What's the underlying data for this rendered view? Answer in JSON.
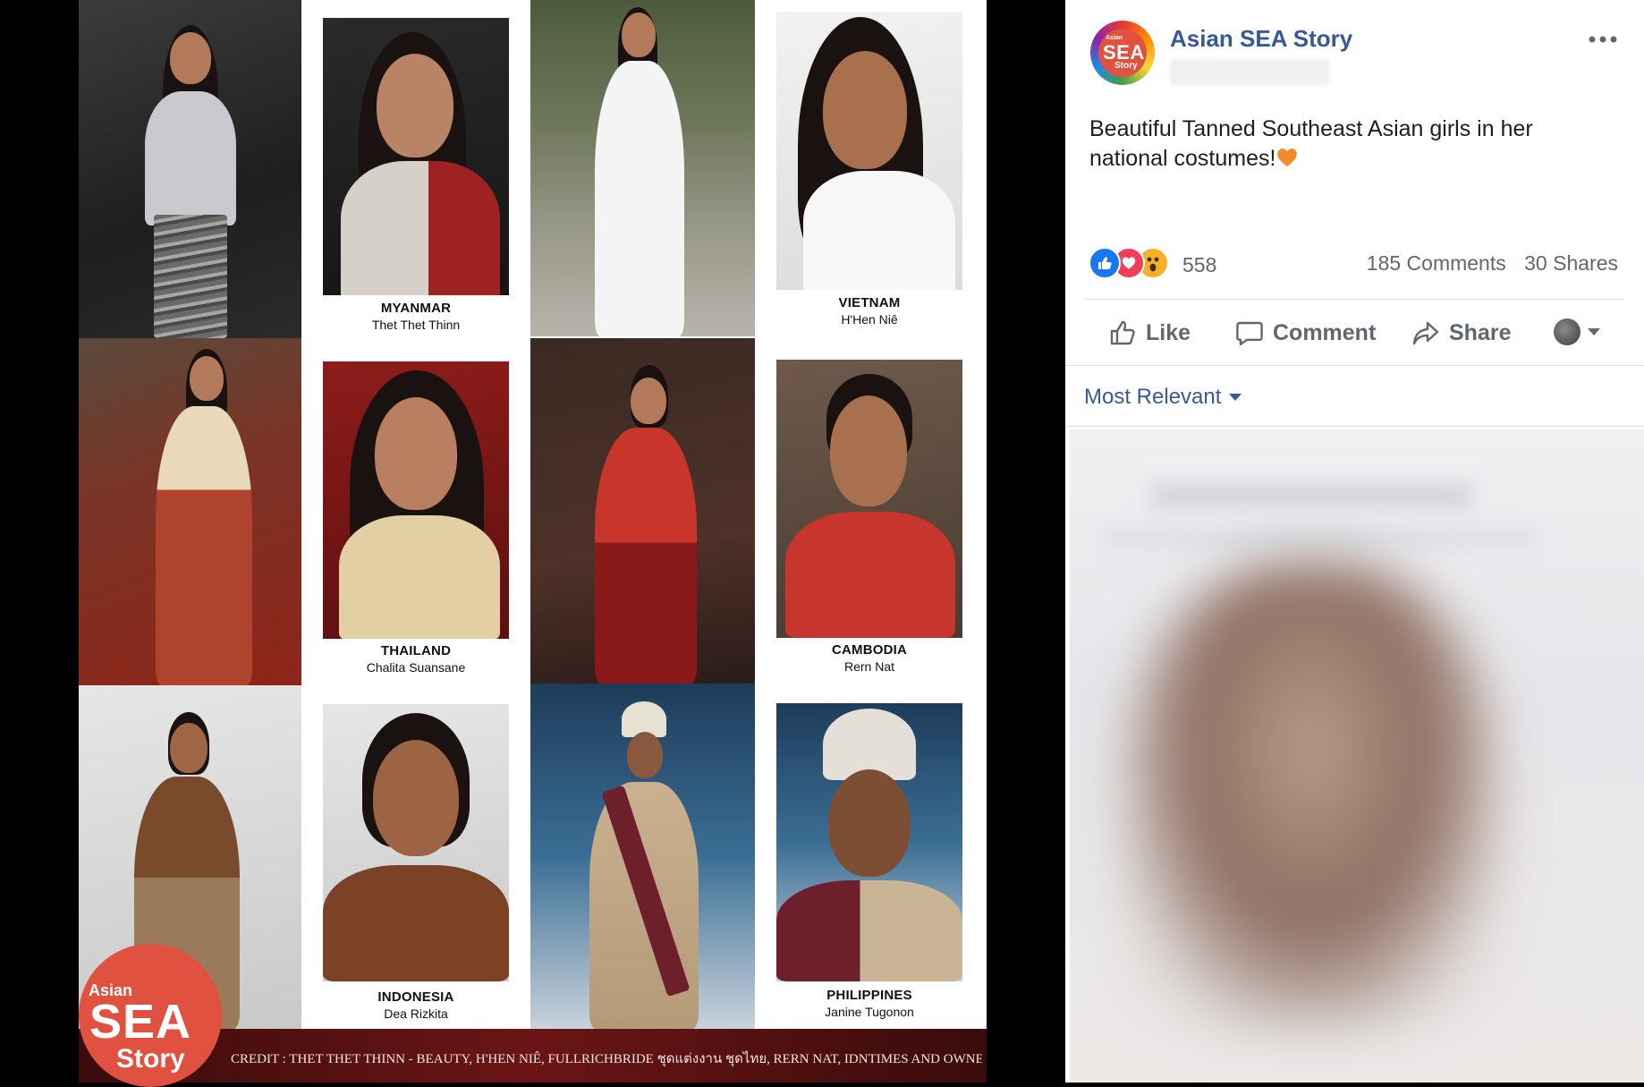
{
  "collage": {
    "panels": [
      {
        "country": "MYANMAR",
        "name": "Thet Thet Thinn"
      },
      {
        "country": "VIETNAM",
        "name": "H'Hen Niê"
      },
      {
        "country": "THAILAND",
        "name": "Chalita Suansane"
      },
      {
        "country": "CAMBODIA",
        "name": "Rern Nat"
      },
      {
        "country": "INDONESIA",
        "name": "Dea Rizkita"
      },
      {
        "country": "PHILIPPINES",
        "name": "Janine Tugonon"
      }
    ],
    "logo": {
      "asian": "Asian",
      "sea": "SEA",
      "story": "Story"
    },
    "credit": "CREDIT : THET THET THINN - BEAUTY, H'HEN NIÊ, FULLRICHBRIDE ชุดแต่งงาน ชุดไทย, RERN NAT, IDNTIMES AND OWNER"
  },
  "post": {
    "avatar": {
      "asian": "Asian",
      "sea": "SEA",
      "story": "Story"
    },
    "page_name": "Asian SEA Story",
    "more_icon": "more-horizontal-icon",
    "text": "Beautiful Tanned Southeast Asian girls in her national costumes!",
    "reactions": {
      "icons": [
        "like-reaction-icon",
        "love-reaction-icon",
        "wow-reaction-icon"
      ],
      "count": "558",
      "comments": "185 Comments",
      "shares": "30 Shares"
    },
    "actions": {
      "like": "Like",
      "comment": "Comment",
      "share": "Share"
    },
    "sort": "Most Relevant"
  },
  "colors": {
    "facebook_blue": "#385898",
    "logo_red": "#e0513f",
    "credit_bar": "#6b1515"
  }
}
